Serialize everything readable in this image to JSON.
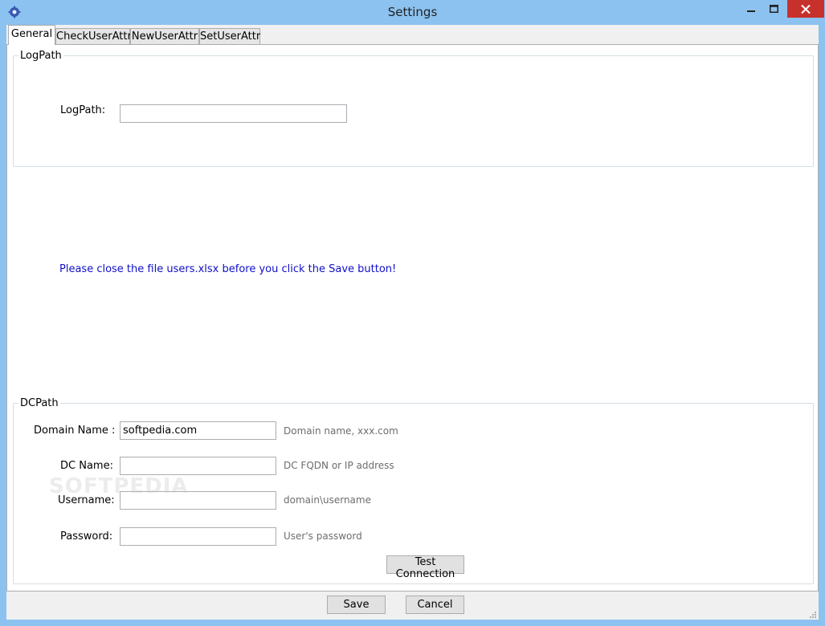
{
  "window": {
    "title": "Settings"
  },
  "tabs": [
    {
      "label": "General",
      "active": true
    },
    {
      "label": "CheckUserAttr",
      "active": false
    },
    {
      "label": "NewUserAttr",
      "active": false
    },
    {
      "label": "SetUserAttr",
      "active": false
    }
  ],
  "logpath_group": {
    "legend": "LogPath",
    "field_label": "LogPath:",
    "field_value": ""
  },
  "notice": "Please close the file users.xlsx before you click the Save button!",
  "dcpath_group": {
    "legend": "DCPath",
    "domain": {
      "label": "Domain Name :",
      "value": "softpedia.com",
      "hint": "Domain name, xxx.com"
    },
    "dc": {
      "label": "DC Name:",
      "value": "",
      "hint": "DC FQDN or IP address"
    },
    "username": {
      "label": "Username:",
      "value": "",
      "hint": "domain\\username"
    },
    "password": {
      "label": "Password:",
      "value": "",
      "hint": "User's password"
    },
    "test_button": "Test Connection"
  },
  "footer": {
    "save_label": "Save",
    "cancel_label": "Cancel"
  },
  "watermark": "SOFTPEDIA",
  "colors": {
    "titlebar": "#8cc2f0",
    "close_button": "#c7312b",
    "notice_text": "#1010c8"
  }
}
